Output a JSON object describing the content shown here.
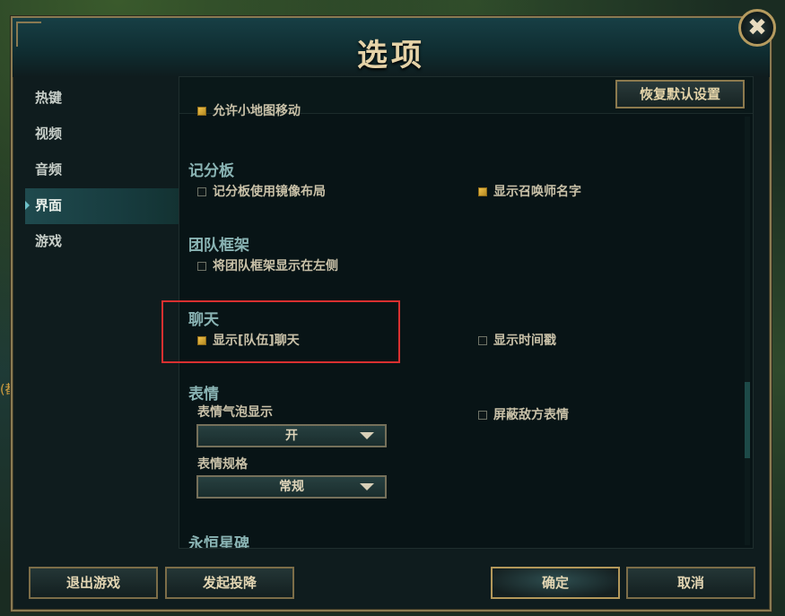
{
  "background_text": "(都",
  "dialog": {
    "title": "选项",
    "close_label": "✖"
  },
  "nav": {
    "items": [
      {
        "label": "热键",
        "active": false
      },
      {
        "label": "视频",
        "active": false
      },
      {
        "label": "音频",
        "active": false
      },
      {
        "label": "界面",
        "active": true
      },
      {
        "label": "游戏",
        "active": false
      }
    ]
  },
  "toolbar": {
    "restore_label": "恢复默认设置"
  },
  "content": {
    "partial_option": {
      "label": "允许小地图移动",
      "checked": true
    },
    "scoreboard": {
      "title": "记分板",
      "mirror_layout": {
        "label": "记分板使用镜像布局",
        "checked": false
      },
      "show_summoner": {
        "label": "显示召唤师名字",
        "checked": true
      }
    },
    "team_frames": {
      "title": "团队框架",
      "show_left": {
        "label": "将团队框架显示在左侧",
        "checked": false
      }
    },
    "chat": {
      "title": "聊天",
      "show_team_chat": {
        "label": "显示[队伍]聊天",
        "checked": true
      },
      "show_timestamp": {
        "label": "显示时间戳",
        "checked": false
      }
    },
    "emotes": {
      "title": "表情",
      "bubble_label": "表情气泡显示",
      "bubble_value": "开",
      "size_label": "表情规格",
      "size_value": "常规",
      "mute_enemy": {
        "label": "屏蔽敌方表情",
        "checked": false
      }
    },
    "eternals": {
      "title": "永恒星碑"
    }
  },
  "footer": {
    "exit_label": "退出游戏",
    "surrender_label": "发起投降",
    "ok_label": "确定",
    "cancel_label": "取消"
  },
  "colors": {
    "accent_gold": "#b59b5f",
    "highlight_red": "#d93030",
    "checkbox_checked": "#f0c14a"
  }
}
